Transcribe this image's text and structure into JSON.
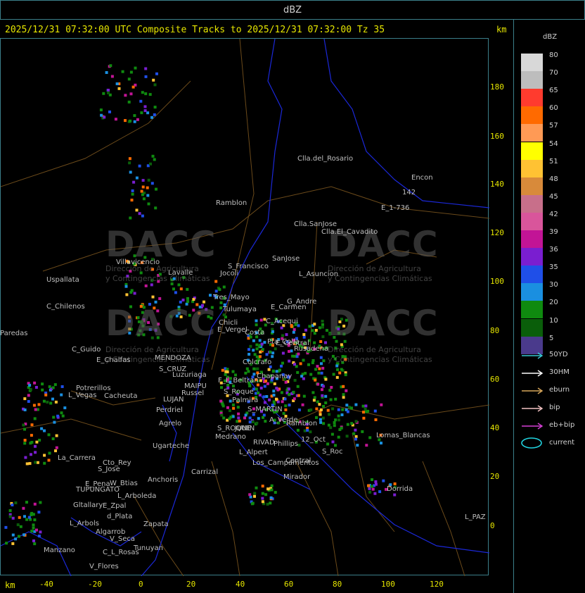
{
  "window": {
    "title": "dBZ"
  },
  "header": {
    "line": "2025/12/31 07:32:00 UTC Composite Tracks to 2025/12/31 07:32:00 Tz 35",
    "km_right": "km",
    "km_bottom": "km"
  },
  "axes": {
    "y_ticks": [
      "180",
      "160",
      "140",
      "120",
      "100",
      "80",
      "60",
      "40",
      "20",
      "0"
    ],
    "x_ticks": [
      "-40",
      "-20",
      "0",
      "20",
      "40",
      "60",
      "80",
      "100",
      "120"
    ]
  },
  "legend": {
    "title": "dBZ",
    "levels": [
      {
        "label": "80",
        "color": "#d8d8d8"
      },
      {
        "label": "70",
        "color": "#bdbdbd"
      },
      {
        "label": "65",
        "color": "#ff3b2e"
      },
      {
        "label": "60",
        "color": "#ff6a00"
      },
      {
        "label": "57",
        "color": "#ff9a55"
      },
      {
        "label": "54",
        "color": "#ffff00"
      },
      {
        "label": "51",
        "color": "#ffc233"
      },
      {
        "label": "48",
        "color": "#d88a3a"
      },
      {
        "label": "45",
        "color": "#c86f8a"
      },
      {
        "label": "42",
        "color": "#d9559b"
      },
      {
        "label": "39",
        "color": "#c21496"
      },
      {
        "label": "36",
        "color": "#7a1ed0"
      },
      {
        "label": "35",
        "color": "#1f4fe8"
      },
      {
        "label": "30",
        "color": "#1a8fe0"
      },
      {
        "label": "20",
        "color": "#0f8a0f"
      },
      {
        "label": "10",
        "color": "#0a5e0a"
      },
      {
        "label": "5",
        "color": "#4a3a8c"
      }
    ],
    "tracks": [
      {
        "label": "50YD",
        "color": "#39c7d6"
      },
      {
        "label": "30HM",
        "color": "#ffffff"
      },
      {
        "label": "eburn",
        "color": "#d8a75a"
      },
      {
        "label": "bip",
        "color": "#f2c2c2"
      },
      {
        "label": "eb+bip",
        "color": "#d640d6"
      }
    ],
    "current_label": "current",
    "current_color": "#21d4e0"
  },
  "watermark": {
    "logo": "DACC",
    "line1": "Dirección de Agricultura",
    "line2": "y Contingencias Climáticas"
  },
  "places": [
    "Clla.del_Rosario",
    "Encon",
    "142",
    "E_1-736",
    "Ramblon",
    "Clla.SanJose",
    "Clla.El_Cavadito",
    "Villavicencio",
    "SanJose",
    "S_Francisco",
    "L_Asuncion",
    "Uspallata",
    "Jocoli",
    "Lavalle",
    "Tres_Mayo",
    "G_Andre",
    "C_Chilenos",
    "Tulumaya",
    "E_Carmen",
    "C_Acequi",
    "E_Vergel",
    "Chicli",
    "Costa",
    "Pta_Colla",
    "E_Central",
    "Rusadena",
    "C_Guido",
    "E_Chalfas",
    "MENDOZA",
    "Colcrafo",
    "S_CRUZ",
    "Luzuriaga",
    "Chapanay",
    "Potrerillos",
    "MAIPU",
    "F_L_Beltran",
    "L_Vegas",
    "Cacheuta",
    "LUJAN",
    "Russel",
    "Palmira",
    "S_Roque",
    "Perdriel",
    "S_MARTIN",
    "Agrelo",
    "A_Verde",
    "Ramblon",
    "S_ROQUE",
    "JUNIN",
    "RIVAD",
    "Phillips",
    "Ugarteche",
    "12_Oct",
    "S_Roc",
    "Lomas_Blancas",
    "Medrano",
    "L_Alpert",
    "Central",
    "La_Carrera",
    "Cto_Rey",
    "S_Jose",
    "Carrizal",
    "Los_Campamentos",
    "Mirador",
    "E_Pena",
    "W_Btias",
    "TUPUNGATO",
    "Anchoris",
    "L_Arboleda",
    "Dorrida",
    "Gltallary",
    "E_Zpal",
    "d_Plata",
    "L_Arbols",
    "Zapata",
    "Algarrob",
    "V_Seca",
    "Tunuyan",
    "Manzano",
    "C_L_Rosas",
    "V_Flores",
    "L_PAZ",
    "Paredas"
  ]
}
